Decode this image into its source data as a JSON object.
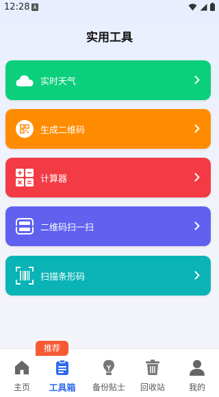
{
  "status_bar": {
    "time": "12:28",
    "notif_letter": "A"
  },
  "page": {
    "title": "实用工具"
  },
  "tools": [
    {
      "label": "实时天气",
      "color": "#0ccf7b",
      "icon": "cloud-icon"
    },
    {
      "label": "生成二维码",
      "color": "#ff8c00",
      "icon": "qr-code-icon"
    },
    {
      "label": "计算器",
      "color": "#f23b45",
      "icon": "calculator-icon"
    },
    {
      "label": "二维码扫一扫",
      "color": "#6062ef",
      "icon": "scan-icon"
    },
    {
      "label": "扫描条形码",
      "color": "#0ab4b6",
      "icon": "barcode-scan-icon"
    }
  ],
  "tab_bar": {
    "badge": "推荐",
    "tabs": [
      {
        "label": "主页",
        "icon": "home-icon",
        "active": false
      },
      {
        "label": "工具箱",
        "icon": "clipboard-icon",
        "active": true
      },
      {
        "label": "备份贴士",
        "icon": "bulb-icon",
        "active": false
      },
      {
        "label": "回收站",
        "icon": "trash-icon",
        "active": false
      },
      {
        "label": "我的",
        "icon": "person-icon",
        "active": false
      }
    ]
  },
  "colors": {
    "accent": "#2f6bea",
    "badge": "#f55a33"
  }
}
